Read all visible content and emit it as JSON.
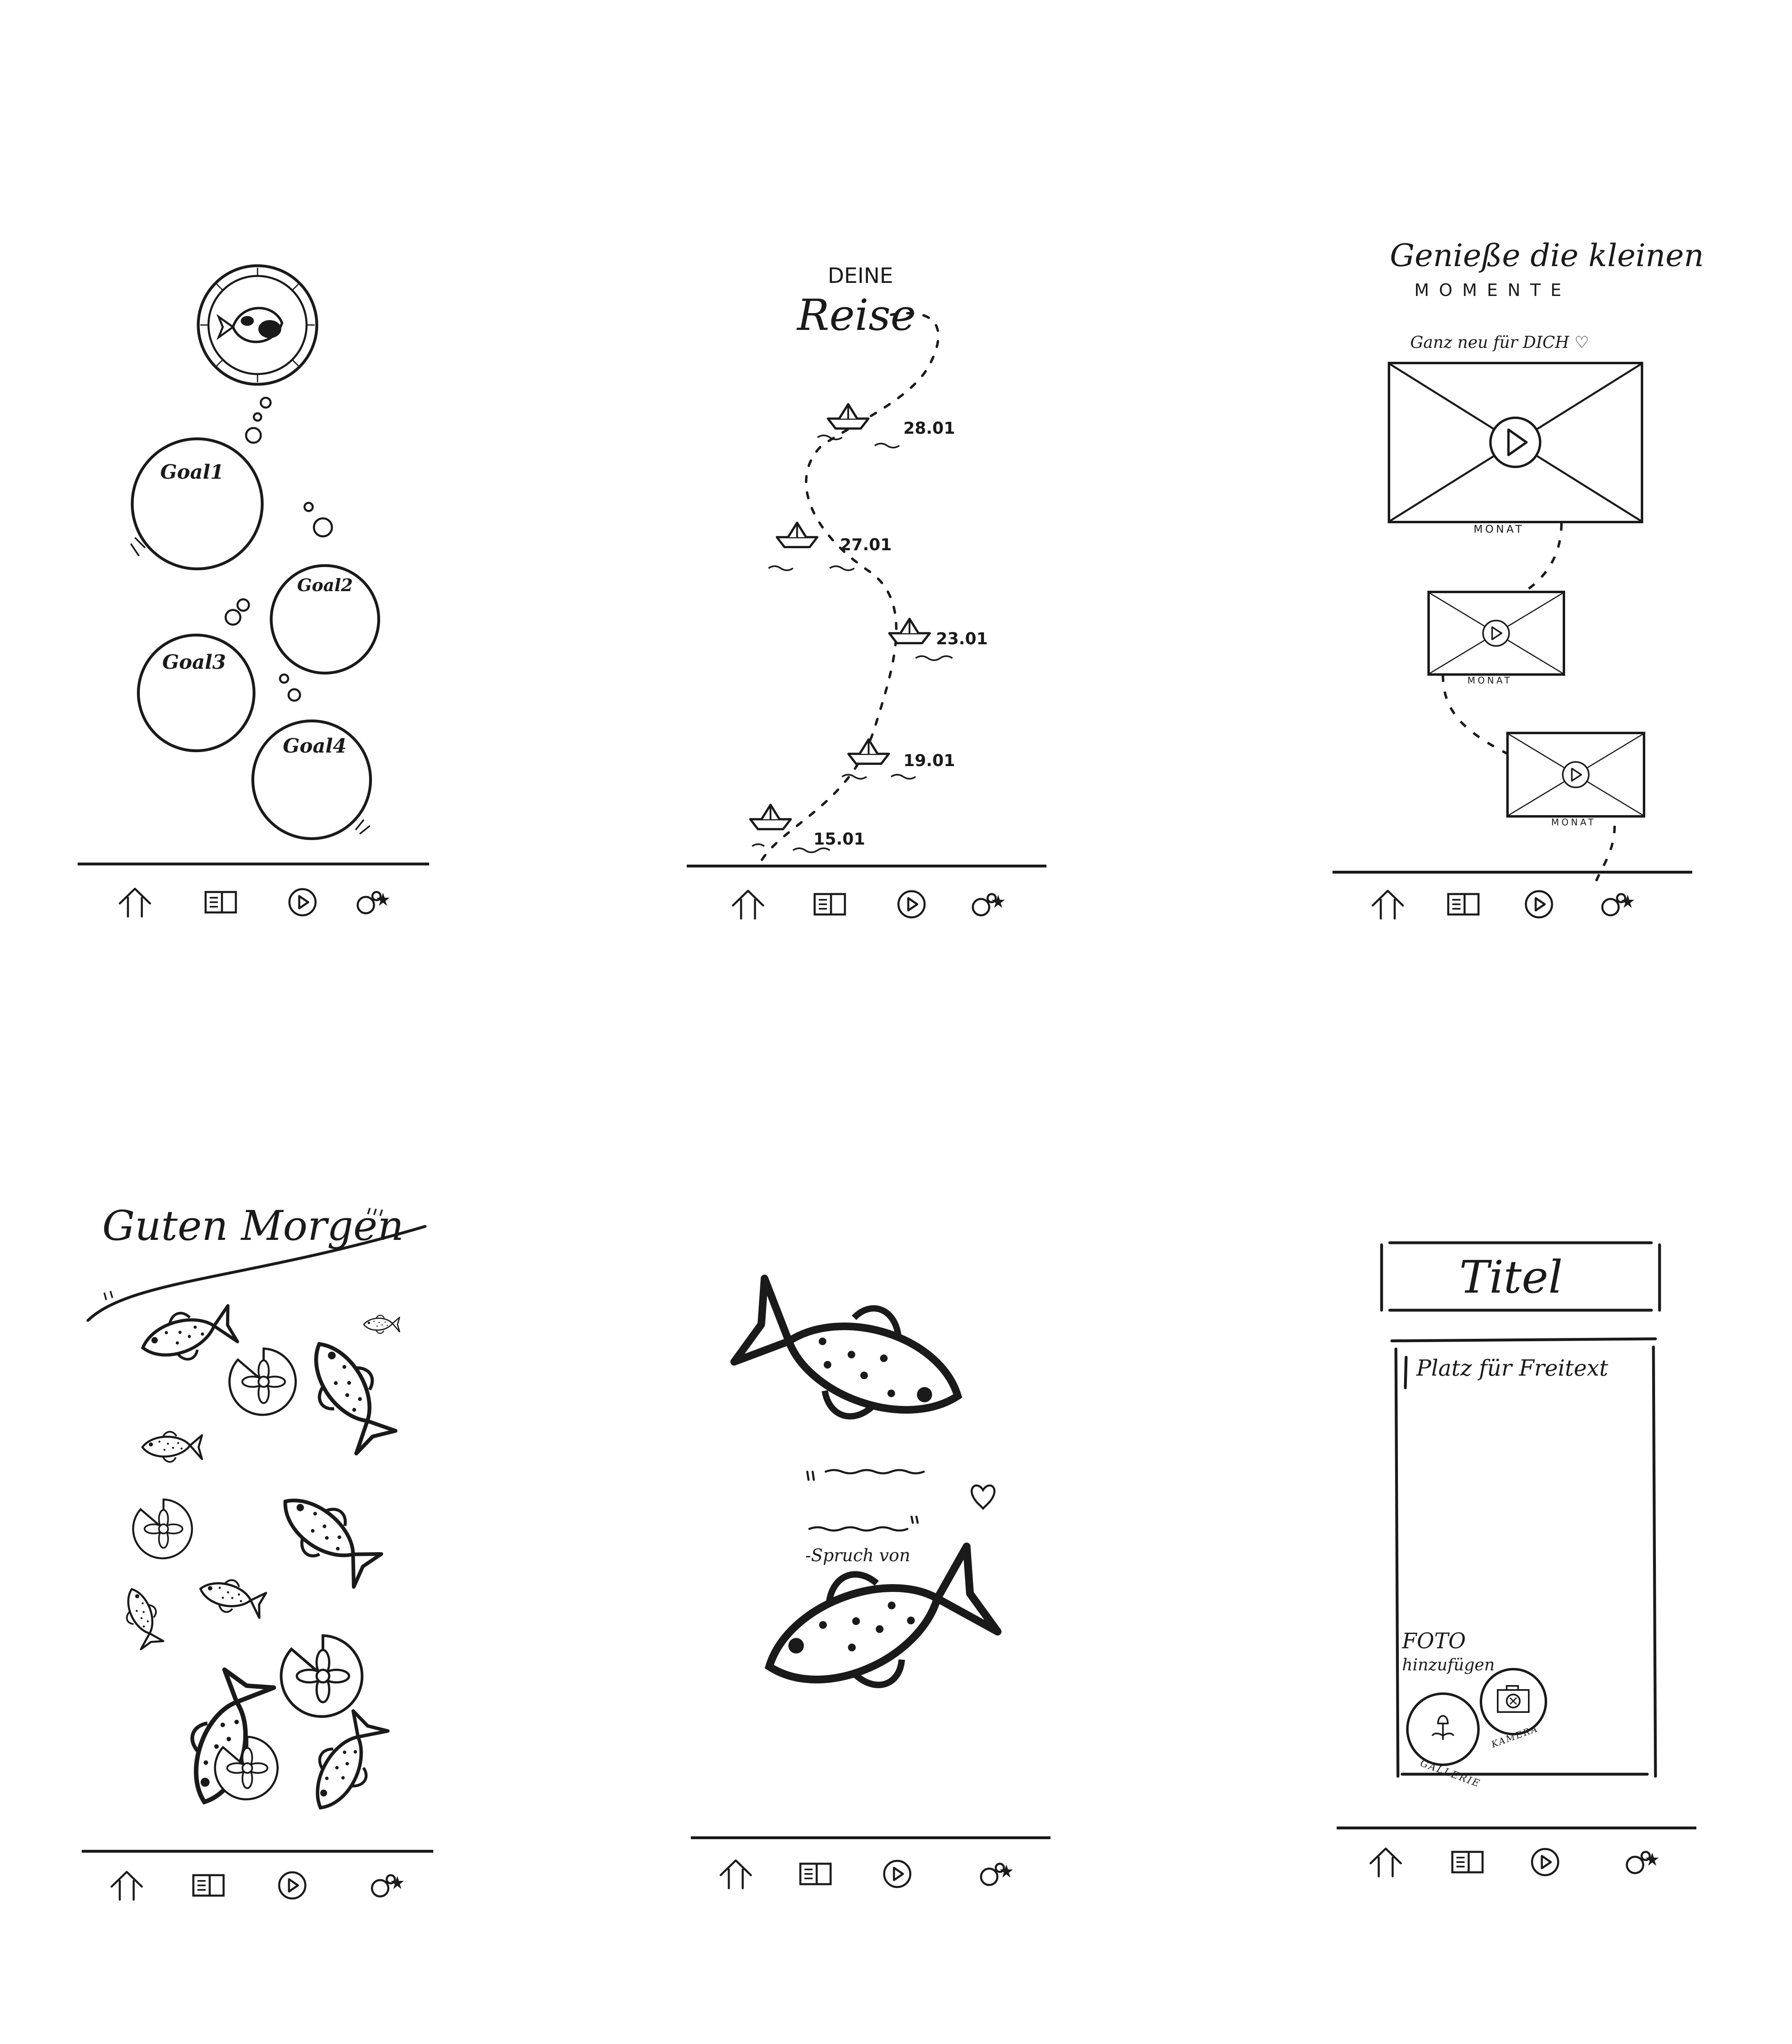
{
  "screens": [
    {
      "id": "goals",
      "goals": [
        "Goal1",
        "Goal2",
        "Goal3",
        "Goal4"
      ],
      "nav": [
        "home-icon",
        "journal-icon",
        "play-icon",
        "bubbles-star-icon"
      ]
    },
    {
      "id": "journey",
      "title_top": "DEINE",
      "title_main": "Reise",
      "dates": [
        "28.01",
        "27.01",
        "23.01",
        "19.01",
        "15.01"
      ],
      "nav": [
        "home-icon",
        "journal-icon",
        "play-icon",
        "bubbles-star-icon"
      ]
    },
    {
      "id": "moments",
      "title_line1": "Genieße die kleinen",
      "title_line2": "MOMENTE",
      "subtitle": "Ganz neu für DICH ♡",
      "videos": [
        {
          "label": "MONAT"
        },
        {
          "label": "MONAT"
        },
        {
          "label": "MONAT"
        }
      ],
      "nav": [
        "home-icon",
        "journal-icon",
        "play-icon",
        "bubbles-star-icon"
      ]
    },
    {
      "id": "greeting",
      "title": "Guten Morgen",
      "nav": [
        "home-icon",
        "journal-icon",
        "play-icon",
        "bubbles-star-icon"
      ]
    },
    {
      "id": "quote",
      "attribution": "-Spruch von",
      "nav": [
        "home-icon",
        "journal-icon",
        "play-icon",
        "bubbles-star-icon"
      ]
    },
    {
      "id": "entry",
      "title": "Titel",
      "placeholder": "Platz für Freitext",
      "photo_line1": "FOTO",
      "photo_line2": "hinzufügen",
      "gallery_label": "GALLERIE",
      "camera_label": "KAMERA",
      "nav": [
        "home-icon",
        "journal-icon",
        "play-icon",
        "bubbles-star-icon"
      ]
    }
  ]
}
